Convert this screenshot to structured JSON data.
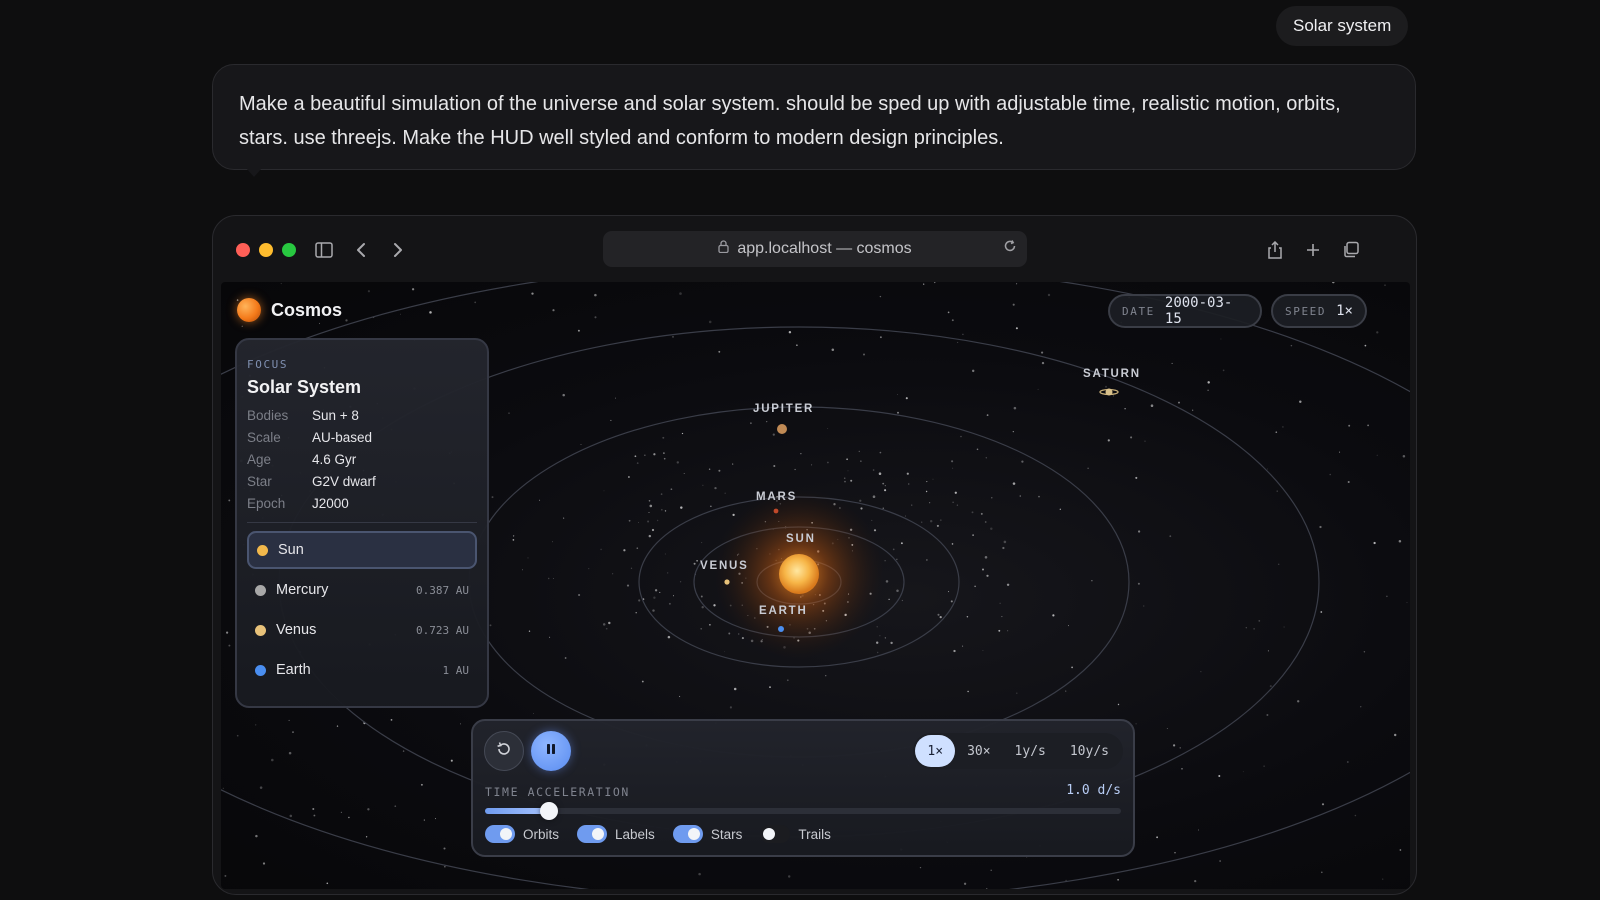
{
  "topic_chip": "Solar system",
  "prompt": "Make a beautiful simulation of the universe and solar system. should be sped up with adjustable time, realistic motion, orbits, stars. use threejs. Make the HUD well styled and conform to modern design principles.",
  "browser": {
    "url": "app.localhost — cosmos",
    "icons": [
      "sidebar-icon",
      "back-icon",
      "forward-icon",
      "lock-icon",
      "reload-icon",
      "share-icon",
      "new-tab-icon",
      "tabs-icon"
    ]
  },
  "app": {
    "brand": "Cosmos",
    "date_label": "DATE",
    "date_value": "2000-03-15",
    "speed_label": "SPEED",
    "speed_value": "1×"
  },
  "focus": {
    "kicker": "FOCUS",
    "title": "Solar System",
    "stats": [
      {
        "key": "Bodies",
        "value": "Sun + 8"
      },
      {
        "key": "Scale",
        "value": "AU-based"
      },
      {
        "key": "Age",
        "value": "4.6 Gyr"
      },
      {
        "key": "Star",
        "value": "G2V dwarf"
      },
      {
        "key": "Epoch",
        "value": "J2000"
      }
    ],
    "bodies": [
      {
        "name": "Sun",
        "au": "",
        "color": "#f2b84b",
        "selected": true
      },
      {
        "name": "Mercury",
        "au": "0.387 AU",
        "color": "#a8a8a8",
        "selected": false
      },
      {
        "name": "Venus",
        "au": "0.723 AU",
        "color": "#e8c27a",
        "selected": false
      },
      {
        "name": "Earth",
        "au": "1 AU",
        "color": "#4a8ef0",
        "selected": false
      }
    ]
  },
  "scene_labels": {
    "saturn": "SATURN",
    "jupiter": "JUPITER",
    "mars": "MARS",
    "sun": "SUN",
    "venus": "VENUS",
    "earth": "EARTH"
  },
  "controls": {
    "speed_options": [
      {
        "label": "1×",
        "active": true
      },
      {
        "label": "30×",
        "active": false
      },
      {
        "label": "1y/s",
        "active": false
      },
      {
        "label": "10y/s",
        "active": false
      }
    ],
    "time_accel_label": "TIME ACCELERATION",
    "time_accel_value": "1.0 d/s",
    "slider_fraction": 0.1,
    "toggles": [
      {
        "label": "Orbits",
        "on": true
      },
      {
        "label": "Labels",
        "on": true
      },
      {
        "label": "Stars",
        "on": true
      },
      {
        "label": "Trails",
        "on": false
      }
    ]
  },
  "colors": {
    "accent": "#6f9bef",
    "sun": "#f5a43a",
    "traffic_red": "#ff5f57",
    "traffic_yellow": "#febc2e",
    "traffic_green": "#28c840"
  }
}
